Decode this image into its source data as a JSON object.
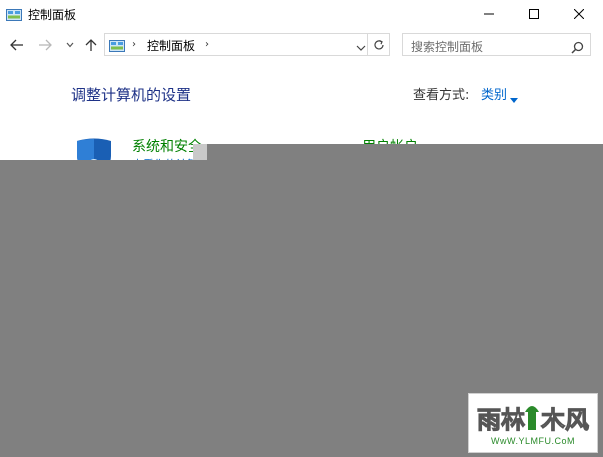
{
  "window": {
    "title": "控制面板"
  },
  "navigation": {
    "breadcrumb": "控制面板",
    "search_placeholder": "搜索控制面板"
  },
  "content": {
    "page_title": "调整计算机的设置",
    "view_by_label": "查看方式:",
    "view_by_value": "类别",
    "categories": [
      {
        "label": "系统和安全",
        "sub": "查看你的计算机",
        "icon": "shield-icon"
      },
      {
        "label": "用户帐户",
        "icon": "user-accounts-icon"
      }
    ]
  },
  "watermark": {
    "url": "WwW.YLMFU.CoM"
  },
  "colors": {
    "title_blue": "#1e3287",
    "link_blue": "#0066cc",
    "category_green": "#008000",
    "overlay_gray": "#808080"
  }
}
